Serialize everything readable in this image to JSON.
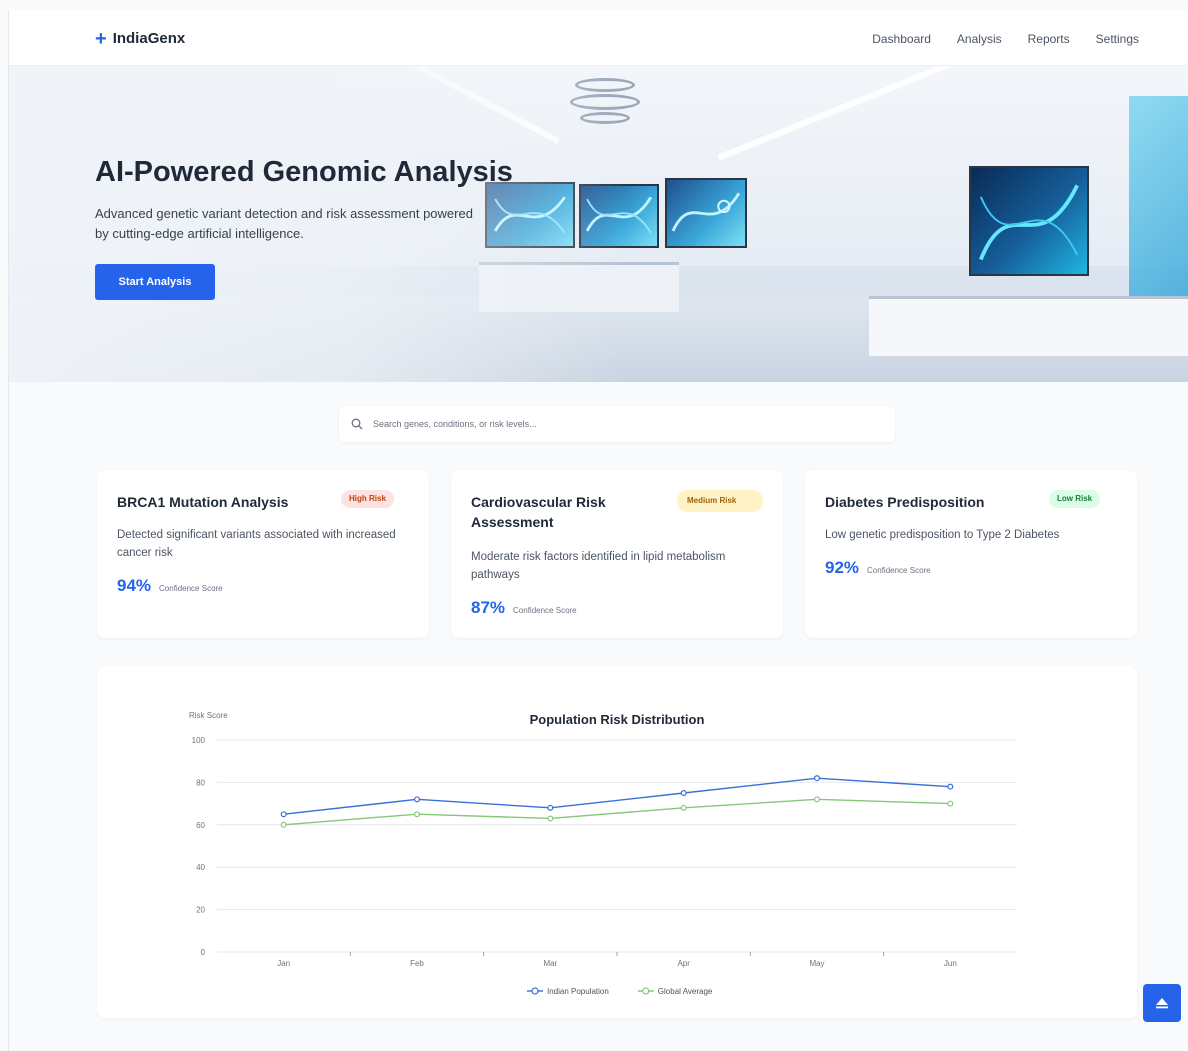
{
  "nav": {
    "brand": "IndiaGenx",
    "links": [
      "Dashboard",
      "Analysis",
      "Reports",
      "Settings"
    ]
  },
  "hero": {
    "title": "AI-Powered Genomic Analysis",
    "subtitle": "Advanced genetic variant detection and risk assessment powered by cutting-edge artificial intelligence.",
    "cta_label": "Start Analysis"
  },
  "search": {
    "placeholder": "Search genes, conditions, or risk levels..."
  },
  "cards": [
    {
      "title": "BRCA1 Mutation Analysis",
      "badge": "High Risk",
      "description": "Detected significant variants associated with increased cancer risk",
      "score": "94%",
      "score_label": "Confidence Score"
    },
    {
      "title": "Cardiovascular Risk Assessment",
      "badge": "Medium Risk",
      "description": "Moderate risk factors identified in lipid metabolism pathways",
      "score": "87%",
      "score_label": "Confidence Score"
    },
    {
      "title": "Diabetes Predisposition",
      "badge": "Low Risk",
      "description": "Low genetic predisposition to Type 2 Diabetes",
      "score": "92%",
      "score_label": "Confidence Score"
    }
  ],
  "colors": {
    "primary": "#2563eb",
    "series_indian": "#3b6fd8",
    "series_global": "#86c77c"
  },
  "chart_data": {
    "type": "line",
    "title": "Population Risk Distribution",
    "ylabel": "Risk Score",
    "xlabel": "",
    "categories": [
      "Jan",
      "Feb",
      "Mar",
      "Apr",
      "May",
      "Jun"
    ],
    "ylim": [
      0,
      100
    ],
    "yticks": [
      0,
      20,
      40,
      60,
      80,
      100
    ],
    "grid": true,
    "legend": "bottom",
    "series": [
      {
        "name": "Indian Population",
        "values": [
          65,
          72,
          68,
          75,
          82,
          78
        ],
        "color": "#3b6fd8"
      },
      {
        "name": "Global Average",
        "values": [
          60,
          65,
          63,
          68,
          72,
          70
        ],
        "color": "#86c77c"
      }
    ]
  }
}
